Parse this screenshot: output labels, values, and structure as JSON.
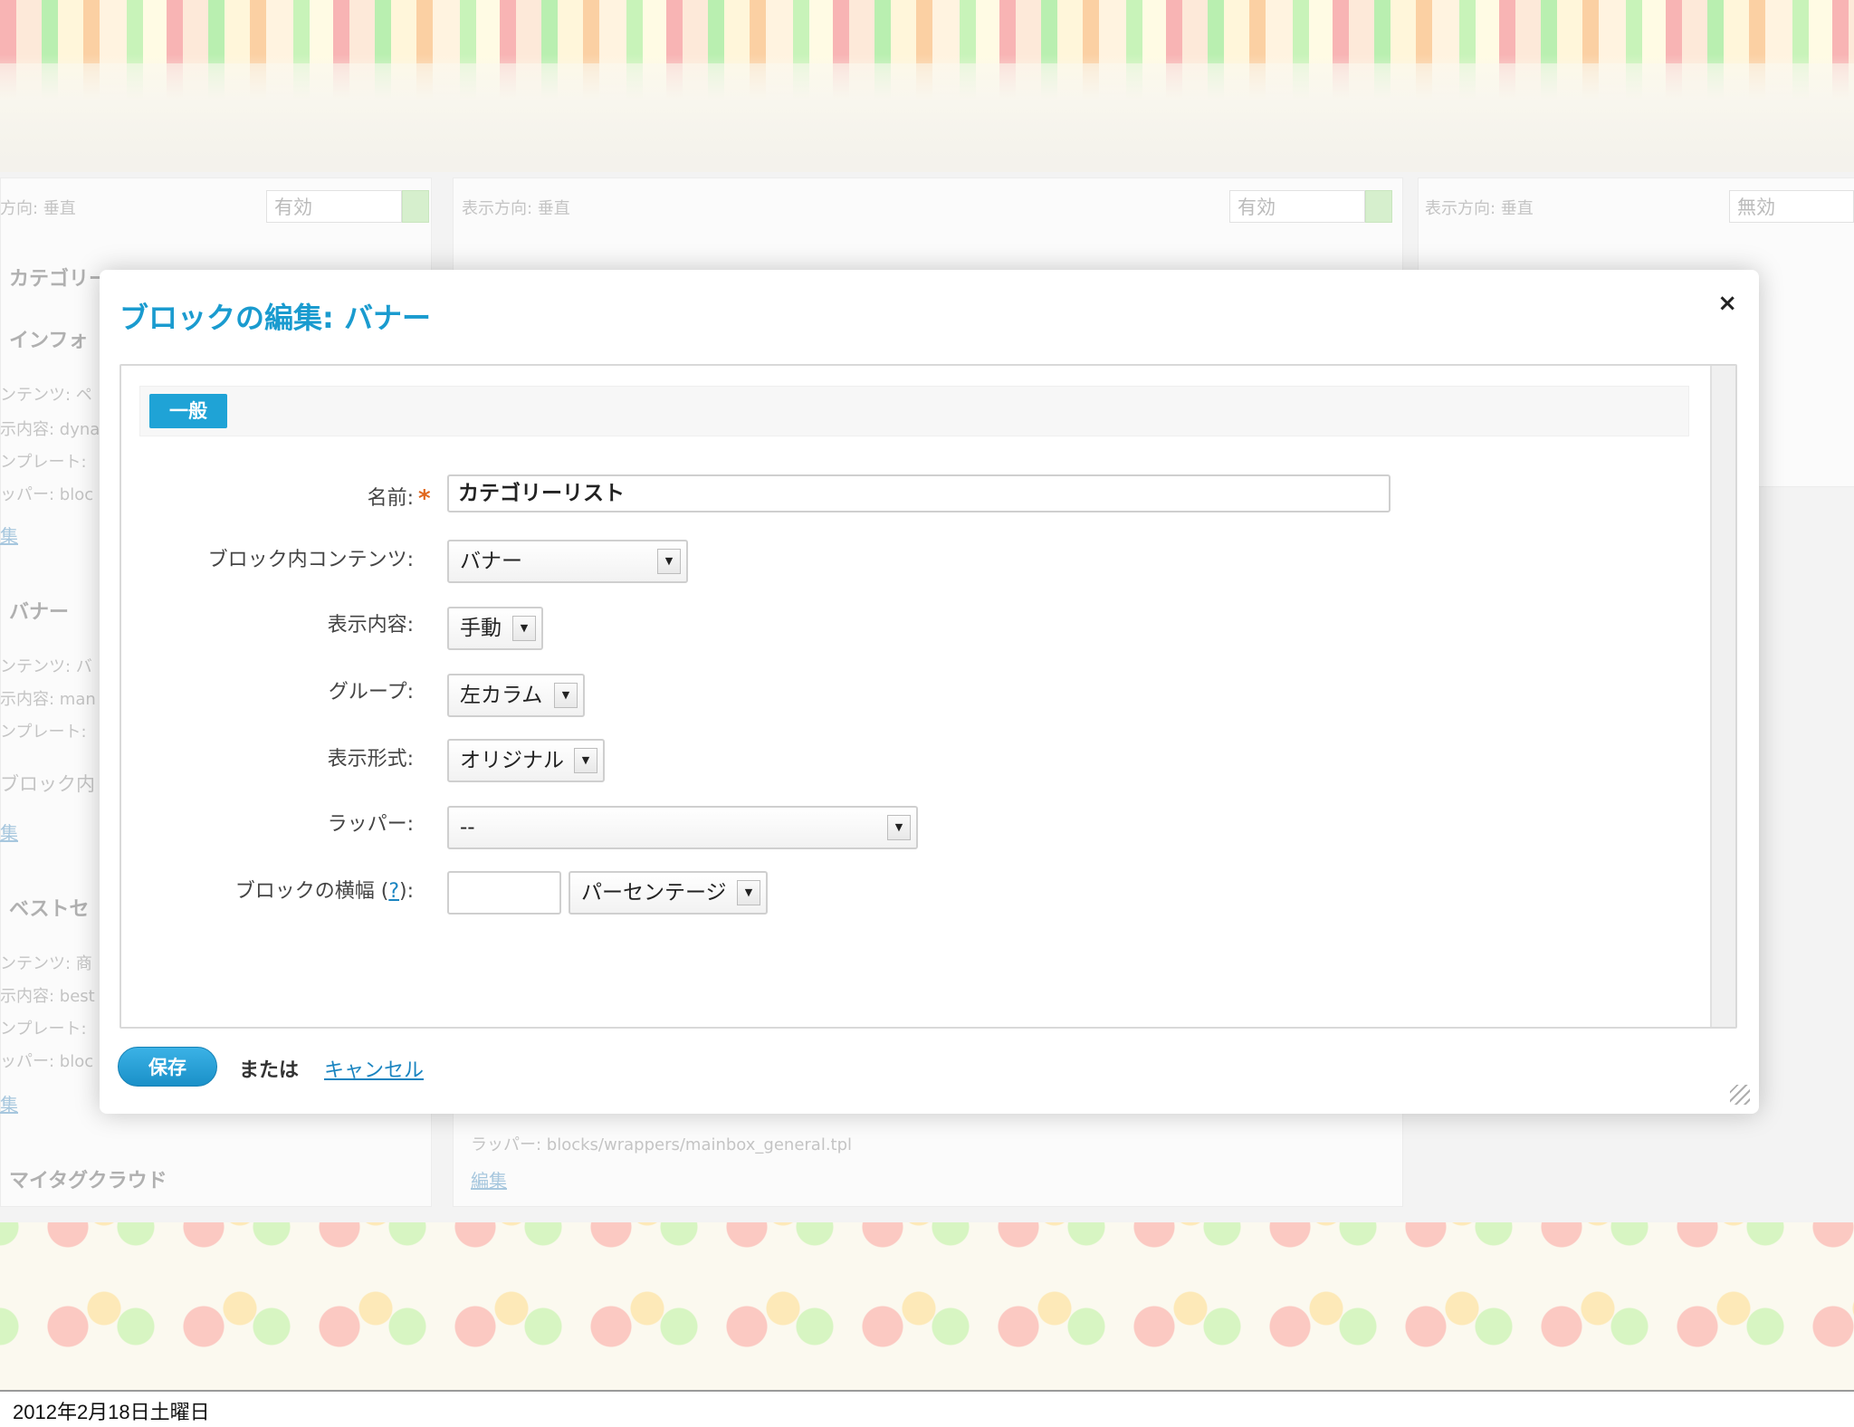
{
  "background": {
    "left_col": {
      "direction": "方向: 垂直",
      "status_select": "有効",
      "items": [
        {
          "title": "カテゴリー",
          "lines": [
            "ンテンツ: ペ",
            "示内容: dyna",
            "ンプレート:",
            "ッパー: bloc"
          ],
          "link": "集"
        },
        {
          "title": "インフォ"
        },
        {
          "title": "バナー",
          "lines": [
            "ンテンツ: バ",
            "示内容: man",
            "ンプレート:",
            "ブロック内"
          ],
          "link": "集"
        },
        {
          "title": "ベストセ",
          "lines": [
            "ンテンツ: 商",
            "示内容: best",
            "ンプレート:",
            "ッパー: bloc"
          ],
          "link": "集"
        },
        {
          "title": "マイタグクラウド"
        }
      ]
    },
    "mid_col": {
      "direction": "表示方向: 垂直",
      "status_select": "有効",
      "wrapper_line": "ラッパー: blocks/wrappers/mainbox_general.tpl",
      "link": "編集"
    },
    "right_col": {
      "direction": "表示方向: 垂直",
      "status_select": "無効"
    }
  },
  "modal": {
    "title": "ブロックの編集: バナー",
    "close_label": "×",
    "tab": "一般",
    "fields": {
      "name_label": "名前:",
      "name_required": "*",
      "name_value": "カテゴリーリスト",
      "content_label": "ブロック内コンテンツ:",
      "content_value": "バナー",
      "display_label": "表示内容:",
      "display_value": "手動",
      "group_label": "グループ:",
      "group_value": "左カラム",
      "format_label": "表示形式:",
      "format_value": "オリジナル",
      "wrapper_label": "ラッパー:",
      "wrapper_value": "--",
      "width_label_pre": "ブロックの横幅 (",
      "width_help": "?",
      "width_label_post": "):",
      "width_value": "",
      "width_unit": "パーセンテージ"
    },
    "footer": {
      "save": "保存",
      "or": "または",
      "cancel": "キャンセル"
    }
  },
  "caption": "2012年2月18日土曜日",
  "colors": {
    "accent": "#1a9bcf",
    "tab": "#1fa3d6",
    "required": "#e0681e",
    "link": "#1a84c0"
  }
}
